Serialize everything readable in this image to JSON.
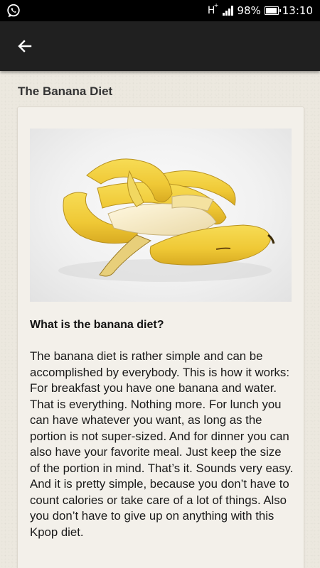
{
  "status_bar": {
    "app_icon": "whatsapp-icon",
    "network_type": "H",
    "network_sup": "+",
    "battery": "98%",
    "battery_level": 0.98,
    "time": "13:10"
  },
  "toolbar": {
    "back_icon": "arrow-left-icon"
  },
  "article": {
    "title": "The Banana Diet",
    "image_icon": "bananas-photo",
    "heading": "What is the banana diet?",
    "body": "The banana diet is rather simple and can be accomplished by everybody. This is how it works: For breakfast you have one banana and water. That is everything. Nothing more. For lunch you can have whatever you want, as long as the portion is not super-sized. And for dinner you can also have your favorite meal. Just keep the size of the portion in mind. That’s it. Sounds very easy. And it is pretty simple, because you don’t have to count calories or take care of a lot of things. Also you don’t have to give up on anything with this Kpop diet."
  },
  "colors": {
    "status_bar": "#000000",
    "toolbar": "#202020",
    "background": "#ece8df",
    "card": "#f3f0ea",
    "banana_yellow": "#f2cf3c"
  }
}
